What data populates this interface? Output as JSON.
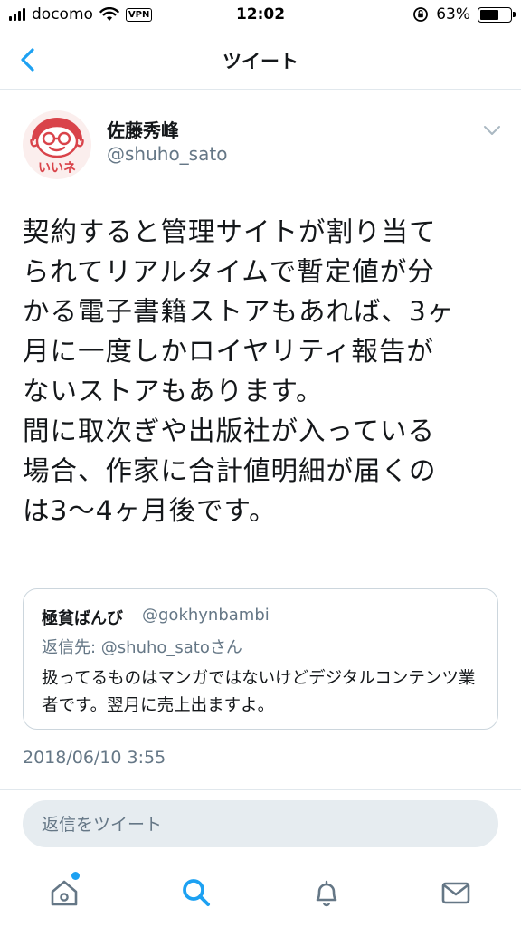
{
  "status_bar": {
    "carrier": "docomo",
    "vpn_label": "VPN",
    "time": "12:02",
    "battery_percent_label": "63%",
    "battery_level": 0.63
  },
  "nav": {
    "title": "ツイート"
  },
  "tweet": {
    "author_name": "佐藤秀峰",
    "author_handle": "@shuho_sato",
    "text": "契約すると管理サイトが割り当て\nられてリアルタイムで暫定値が分\nかる電子書籍ストアもあれば、3ヶ\n月に一度しかロイヤリティ報告が\nないストアもあります。\n間に取次ぎや出版社が入っている\n場合、作家に合計値明細が届くの\nは3〜4ヶ月後です。",
    "timestamp": "2018/06/10 3:55"
  },
  "quoted_tweet": {
    "author_name": "極貧ばんび",
    "author_handle": "@gokhynbambi",
    "reply_to": "返信先: @shuho_satoさん",
    "text": "扱ってるものはマンガではないけどデジタルコンテンツ業者です。翌月に売上出ますよ。"
  },
  "reply": {
    "placeholder": "返信をツイート"
  },
  "avatar": {
    "logo_text": "いいネ"
  },
  "tabbar": {
    "items": [
      "home-icon",
      "search-icon",
      "notifications-icon",
      "messages-icon"
    ],
    "active": "search-icon"
  },
  "colors": {
    "accent": "#1da1f2",
    "secondary_text": "#657786",
    "primary_text": "#14171a",
    "avatar_red": "#d9434a"
  }
}
